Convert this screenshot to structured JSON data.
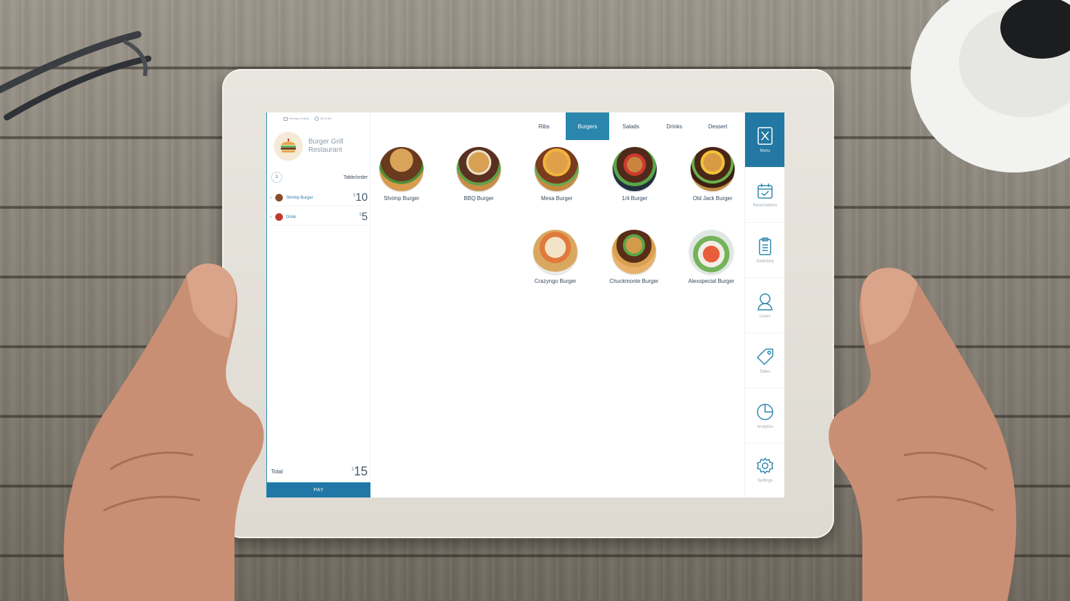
{
  "status": {
    "date": "Monday 04 April",
    "time": "08:00 AM"
  },
  "restaurant": {
    "name_line1": "Burger Grill",
    "name_line2": "Restaurant"
  },
  "order": {
    "table_number": "3",
    "table_label": "Table/order",
    "items": [
      {
        "remove": "x",
        "name": "Shrimp Burger",
        "currency": "$",
        "price": "10",
        "color": "#8a4a2a"
      },
      {
        "remove": "x",
        "name": "Drink",
        "currency": "$",
        "price": "5",
        "color": "#c0392b"
      }
    ],
    "total_label": "Total",
    "total_currency": "$",
    "total_value": "15",
    "pay_label": "PAY"
  },
  "tabs": [
    {
      "label": "Ribs",
      "active": false
    },
    {
      "label": "Burgers",
      "active": true
    },
    {
      "label": "Salads",
      "active": false
    },
    {
      "label": "Drinks",
      "active": false
    },
    {
      "label": "Dessert",
      "active": false
    }
  ],
  "products": [
    {
      "label": "Shrimp Burger"
    },
    {
      "label": "BBQ Burger"
    },
    {
      "label": "Mesa Burger"
    },
    {
      "label": "1/4 Burger"
    },
    {
      "label": "Old Jack Burger"
    },
    {
      "label": "Crazyngo Burger"
    },
    {
      "label": "Chuckmonte Burger"
    },
    {
      "label": "Alexspecial Burger"
    }
  ],
  "nav": [
    {
      "label": "Menu",
      "icon": "menu-icon",
      "active": true
    },
    {
      "label": "Reservations",
      "icon": "calendar-check-icon",
      "active": false
    },
    {
      "label": "Inventory",
      "icon": "clipboard-icon",
      "active": false
    },
    {
      "label": "Users",
      "icon": "user-icon",
      "active": false
    },
    {
      "label": "Sales",
      "icon": "tag-icon",
      "active": false
    },
    {
      "label": "Analytics",
      "icon": "pie-chart-icon",
      "active": false
    },
    {
      "label": "Settings",
      "icon": "gear-icon",
      "active": false
    }
  ],
  "colors": {
    "accent": "#2b86ad",
    "pay": "#2178a6"
  }
}
